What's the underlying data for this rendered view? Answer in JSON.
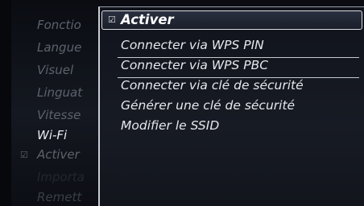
{
  "left_menu": {
    "items": [
      {
        "label": "Fonctio"
      },
      {
        "label": "Langue"
      },
      {
        "label": "Visuel"
      },
      {
        "label": "Linguat"
      },
      {
        "label": "Vitesse"
      },
      {
        "label": "Wi-Fi"
      },
      {
        "label": "Activer"
      },
      {
        "label": "Importa"
      },
      {
        "label": "Remett"
      }
    ],
    "check_glyph": "☑"
  },
  "popup": {
    "check_glyph": "☑",
    "items": [
      {
        "label": "Activer"
      },
      {
        "label": "Connecter via WPS PIN"
      },
      {
        "label": "Connecter via WPS PBC"
      },
      {
        "label": "Connecter via clé de sécurité"
      },
      {
        "label": "Générer une clé de sécurité"
      },
      {
        "label": "Modifier le SSID"
      }
    ]
  }
}
